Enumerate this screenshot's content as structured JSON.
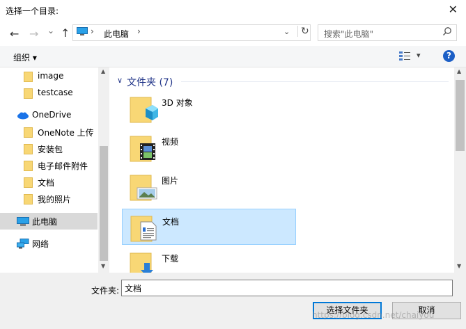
{
  "window": {
    "title": "选择一个目录:"
  },
  "nav": {
    "back": "←",
    "forward": "→",
    "recent": "⌄",
    "up": "↑",
    "address": {
      "location": "此电脑"
    },
    "search": {
      "placeholder": "搜索\"此电脑\""
    }
  },
  "toolbar": {
    "organize": "组织 ▾",
    "help": "?"
  },
  "sidebar": {
    "items": [
      {
        "label": "image",
        "type": "folder"
      },
      {
        "label": "testcase",
        "type": "folder"
      },
      {
        "label": "OneDrive",
        "type": "cloud"
      },
      {
        "label": "OneNote 上传",
        "type": "folder"
      },
      {
        "label": "安装包",
        "type": "folder"
      },
      {
        "label": "电子邮件附件",
        "type": "folder"
      },
      {
        "label": "文档",
        "type": "folder"
      },
      {
        "label": "我的照片",
        "type": "folder"
      },
      {
        "label": "此电脑",
        "type": "pc",
        "selected": true
      },
      {
        "label": "网络",
        "type": "network"
      }
    ]
  },
  "main": {
    "group_title": "文件夹 (7)",
    "folders": [
      {
        "label": "3D 对象",
        "icon": "cube-folder-icon"
      },
      {
        "label": "视频",
        "icon": "video-folder-icon"
      },
      {
        "label": "图片",
        "icon": "pictures-folder-icon"
      },
      {
        "label": "文档",
        "icon": "documents-folder-icon",
        "selected": true
      },
      {
        "label": "下载",
        "icon": "downloads-folder-icon"
      }
    ]
  },
  "footer": {
    "folder_label": "文件夹:",
    "folder_value": "文档",
    "select_button": "选择文件夹",
    "cancel_button": "取消",
    "watermark": "https://blog.csdn.net/chaiyou"
  },
  "colors": {
    "accent": "#0078d7",
    "selection": "#cce8ff",
    "group_title": "#1e3287",
    "folder": "#f8d775"
  }
}
